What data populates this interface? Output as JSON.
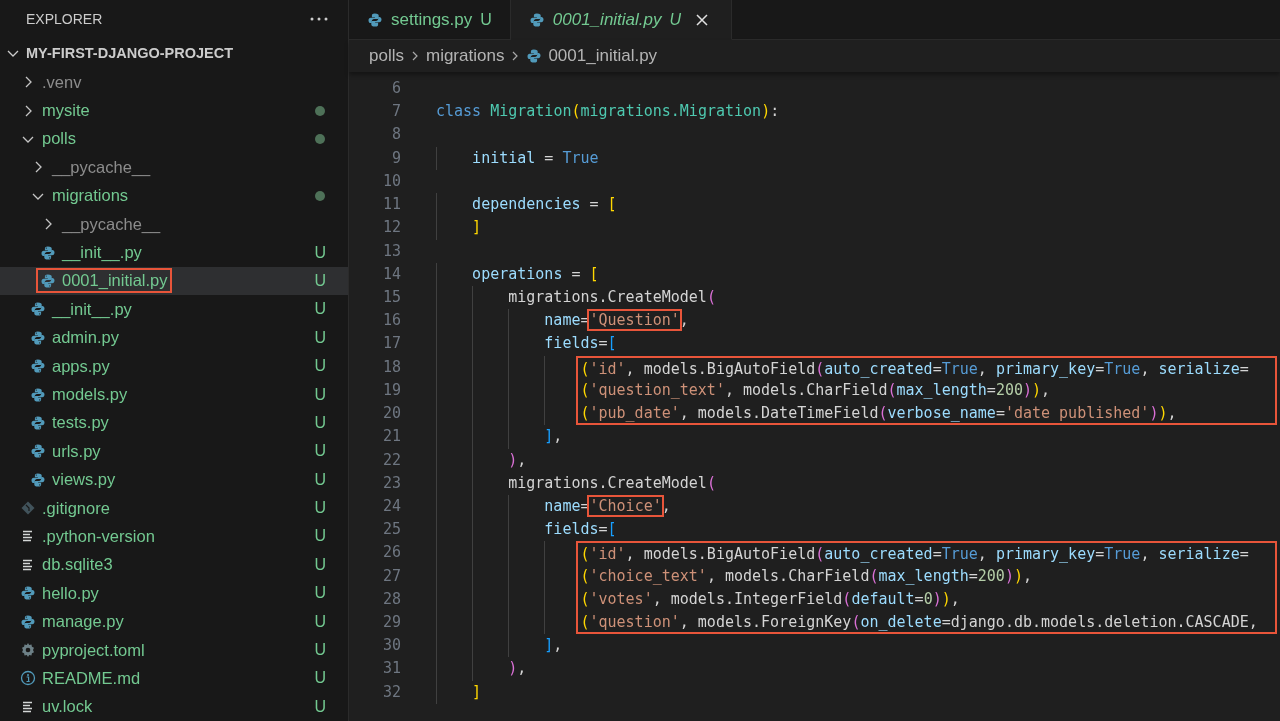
{
  "sidebar": {
    "title": "EXPLORER",
    "project": {
      "name": "MY-FIRST-DJANGO-PROJECT",
      "expanded": true
    },
    "tree": [
      {
        "name": ".venv",
        "kind": "folder",
        "expanded": false,
        "dimmed": true,
        "modified": false,
        "selected": false
      },
      {
        "name": "mysite",
        "kind": "folder",
        "expanded": false,
        "dimmed": false,
        "modified": true,
        "selected": false
      },
      {
        "name": "polls",
        "kind": "folder",
        "expanded": true,
        "dimmed": false,
        "modified": true,
        "selected": false,
        "children": [
          {
            "name": "__pycache__",
            "kind": "folder",
            "expanded": false,
            "dimmed": true,
            "modified": false,
            "selected": false
          },
          {
            "name": "migrations",
            "kind": "folder",
            "expanded": true,
            "dimmed": false,
            "modified": true,
            "selected": false,
            "children": [
              {
                "name": "__pycache__",
                "kind": "folder",
                "expanded": false,
                "dimmed": true,
                "modified": false,
                "selected": false
              },
              {
                "name": "__init__.py",
                "kind": "python",
                "status": "U",
                "selected": false
              },
              {
                "name": "0001_initial.py",
                "kind": "python",
                "status": "U",
                "selected": true,
                "marked": true
              }
            ]
          },
          {
            "name": "__init__.py",
            "kind": "python",
            "status": "U",
            "selected": false
          },
          {
            "name": "admin.py",
            "kind": "python",
            "status": "U",
            "selected": false
          },
          {
            "name": "apps.py",
            "kind": "python",
            "status": "U",
            "selected": false
          },
          {
            "name": "models.py",
            "kind": "python",
            "status": "U",
            "selected": false
          },
          {
            "name": "tests.py",
            "kind": "python",
            "status": "U",
            "selected": false
          },
          {
            "name": "urls.py",
            "kind": "python",
            "status": "U",
            "selected": false
          },
          {
            "name": "views.py",
            "kind": "python",
            "status": "U",
            "selected": false
          }
        ]
      },
      {
        "name": ".gitignore",
        "kind": "git",
        "status": "U",
        "selected": false
      },
      {
        "name": ".python-version",
        "kind": "text",
        "status": "U",
        "selected": false
      },
      {
        "name": "db.sqlite3",
        "kind": "text",
        "status": "U",
        "selected": false
      },
      {
        "name": "hello.py",
        "kind": "python",
        "status": "U",
        "selected": false
      },
      {
        "name": "manage.py",
        "kind": "python",
        "status": "U",
        "selected": false
      },
      {
        "name": "pyproject.toml",
        "kind": "gear",
        "status": "U",
        "selected": false
      },
      {
        "name": "README.md",
        "kind": "info",
        "status": "U",
        "selected": false
      },
      {
        "name": "uv.lock",
        "kind": "text",
        "status": "U",
        "selected": false
      }
    ]
  },
  "tabs": [
    {
      "label": "settings.py",
      "status": "U",
      "selected": false,
      "preview": false
    },
    {
      "label": "0001_initial.py",
      "status": "U",
      "selected": true,
      "preview": true
    }
  ],
  "breadcrumb": [
    "polls",
    "migrations",
    "0001_initial.py"
  ],
  "editor": {
    "lines": [
      {
        "number": "6"
      },
      {
        "number": "7",
        "tokens": [
          {
            "text": "class ",
            "kind": "kw"
          },
          {
            "text": "Migration",
            "kind": "cls"
          },
          {
            "text": "(",
            "kind": "b1"
          },
          {
            "text": "migrations.Migration",
            "kind": "cls"
          },
          {
            "text": ")",
            "kind": "b1"
          },
          {
            "text": ":",
            "kind": "plain"
          }
        ]
      },
      {
        "number": "8"
      },
      {
        "number": "9",
        "tokens": [
          {
            "text": "    initial",
            "kind": "var"
          },
          {
            "text": " = ",
            "kind": "plain"
          },
          {
            "text": "True",
            "kind": "const"
          }
        ]
      },
      {
        "number": "10"
      },
      {
        "number": "11",
        "tokens": [
          {
            "text": "    dependencies",
            "kind": "var"
          },
          {
            "text": " = ",
            "kind": "plain"
          },
          {
            "text": "[",
            "kind": "b1"
          }
        ]
      },
      {
        "number": "12",
        "tokens": [
          {
            "text": "    ]",
            "kind": "b1"
          }
        ]
      },
      {
        "number": "13"
      },
      {
        "number": "14",
        "tokens": [
          {
            "text": "    operations",
            "kind": "var"
          },
          {
            "text": " = ",
            "kind": "plain"
          },
          {
            "text": "[",
            "kind": "b1"
          }
        ]
      },
      {
        "number": "15",
        "tokens": [
          {
            "text": "        migrations.CreateModel",
            "kind": "plain"
          },
          {
            "text": "(",
            "kind": "b2"
          }
        ]
      },
      {
        "number": "16",
        "tokens": [
          {
            "text": "            name",
            "kind": "var"
          },
          {
            "text": "=",
            "kind": "plain"
          },
          {
            "text": "'Question'",
            "kind": "str",
            "boxed": true
          },
          {
            "text": ",",
            "kind": "plain"
          }
        ]
      },
      {
        "number": "17",
        "tokens": [
          {
            "text": "            fields",
            "kind": "var"
          },
          {
            "text": "=",
            "kind": "plain"
          },
          {
            "text": "[",
            "kind": "b3"
          }
        ]
      },
      {
        "number": "18",
        "boxed": true,
        "tokens": [
          {
            "text": "                (",
            "kind": "b1"
          },
          {
            "text": "'id'",
            "kind": "str"
          },
          {
            "text": ", models.BigAutoField",
            "kind": "plain"
          },
          {
            "text": "(",
            "kind": "b2"
          },
          {
            "text": "auto_created",
            "kind": "var"
          },
          {
            "text": "=",
            "kind": "plain"
          },
          {
            "text": "True",
            "kind": "const"
          },
          {
            "text": ", ",
            "kind": "plain"
          },
          {
            "text": "primary_key",
            "kind": "var"
          },
          {
            "text": "=",
            "kind": "plain"
          },
          {
            "text": "True",
            "kind": "const"
          },
          {
            "text": ", ",
            "kind": "plain"
          },
          {
            "text": "serialize",
            "kind": "var"
          },
          {
            "text": "=",
            "kind": "plain"
          }
        ]
      },
      {
        "number": "19",
        "boxed": true,
        "tokens": [
          {
            "text": "                (",
            "kind": "b1"
          },
          {
            "text": "'question_text'",
            "kind": "str"
          },
          {
            "text": ", models.CharField",
            "kind": "plain"
          },
          {
            "text": "(",
            "kind": "b2"
          },
          {
            "text": "max_length",
            "kind": "var"
          },
          {
            "text": "=",
            "kind": "plain"
          },
          {
            "text": "200",
            "kind": "num"
          },
          {
            "text": ")",
            "kind": "b2"
          },
          {
            "text": ")",
            "kind": "b1"
          },
          {
            "text": ",",
            "kind": "plain"
          }
        ]
      },
      {
        "number": "20",
        "boxed": true,
        "tokens": [
          {
            "text": "                (",
            "kind": "b1"
          },
          {
            "text": "'pub_date'",
            "kind": "str"
          },
          {
            "text": ", models.DateTimeField",
            "kind": "plain"
          },
          {
            "text": "(",
            "kind": "b2"
          },
          {
            "text": "verbose_name",
            "kind": "var"
          },
          {
            "text": "=",
            "kind": "plain"
          },
          {
            "text": "'date published'",
            "kind": "str"
          },
          {
            "text": ")",
            "kind": "b2"
          },
          {
            "text": ")",
            "kind": "b1"
          },
          {
            "text": ",",
            "kind": "plain"
          }
        ]
      },
      {
        "number": "21",
        "tokens": [
          {
            "text": "            ]",
            "kind": "b3"
          },
          {
            "text": ",",
            "kind": "plain"
          }
        ]
      },
      {
        "number": "22",
        "tokens": [
          {
            "text": "        )",
            "kind": "b2"
          },
          {
            "text": ",",
            "kind": "plain"
          }
        ]
      },
      {
        "number": "23",
        "tokens": [
          {
            "text": "        migrations.CreateModel",
            "kind": "plain"
          },
          {
            "text": "(",
            "kind": "b2"
          }
        ]
      },
      {
        "number": "24",
        "tokens": [
          {
            "text": "            name",
            "kind": "var"
          },
          {
            "text": "=",
            "kind": "plain"
          },
          {
            "text": "'Choice'",
            "kind": "str",
            "boxed": true
          },
          {
            "text": ",",
            "kind": "plain"
          }
        ]
      },
      {
        "number": "25",
        "tokens": [
          {
            "text": "            fields",
            "kind": "var"
          },
          {
            "text": "=",
            "kind": "plain"
          },
          {
            "text": "[",
            "kind": "b3"
          }
        ]
      },
      {
        "number": "26",
        "boxed": true,
        "tokens": [
          {
            "text": "                (",
            "kind": "b1"
          },
          {
            "text": "'id'",
            "kind": "str"
          },
          {
            "text": ", models.BigAutoField",
            "kind": "plain"
          },
          {
            "text": "(",
            "kind": "b2"
          },
          {
            "text": "auto_created",
            "kind": "var"
          },
          {
            "text": "=",
            "kind": "plain"
          },
          {
            "text": "True",
            "kind": "const"
          },
          {
            "text": ", ",
            "kind": "plain"
          },
          {
            "text": "primary_key",
            "kind": "var"
          },
          {
            "text": "=",
            "kind": "plain"
          },
          {
            "text": "True",
            "kind": "const"
          },
          {
            "text": ", ",
            "kind": "plain"
          },
          {
            "text": "serialize",
            "kind": "var"
          },
          {
            "text": "=",
            "kind": "plain"
          }
        ]
      },
      {
        "number": "27",
        "boxed": true,
        "tokens": [
          {
            "text": "                (",
            "kind": "b1"
          },
          {
            "text": "'choice_text'",
            "kind": "str"
          },
          {
            "text": ", models.CharField",
            "kind": "plain"
          },
          {
            "text": "(",
            "kind": "b2"
          },
          {
            "text": "max_length",
            "kind": "var"
          },
          {
            "text": "=",
            "kind": "plain"
          },
          {
            "text": "200",
            "kind": "num"
          },
          {
            "text": ")",
            "kind": "b2"
          },
          {
            "text": ")",
            "kind": "b1"
          },
          {
            "text": ",",
            "kind": "plain"
          }
        ]
      },
      {
        "number": "28",
        "boxed": true,
        "tokens": [
          {
            "text": "                (",
            "kind": "b1"
          },
          {
            "text": "'votes'",
            "kind": "str"
          },
          {
            "text": ", models.IntegerField",
            "kind": "plain"
          },
          {
            "text": "(",
            "kind": "b2"
          },
          {
            "text": "default",
            "kind": "var"
          },
          {
            "text": "=",
            "kind": "plain"
          },
          {
            "text": "0",
            "kind": "num"
          },
          {
            "text": ")",
            "kind": "b2"
          },
          {
            "text": ")",
            "kind": "b1"
          },
          {
            "text": ",",
            "kind": "plain"
          }
        ]
      },
      {
        "number": "29",
        "boxed": true,
        "tokens": [
          {
            "text": "                (",
            "kind": "b1"
          },
          {
            "text": "'question'",
            "kind": "str"
          },
          {
            "text": ", models.ForeignKey",
            "kind": "plain"
          },
          {
            "text": "(",
            "kind": "b2"
          },
          {
            "text": "on_delete",
            "kind": "var"
          },
          {
            "text": "=",
            "kind": "plain"
          },
          {
            "text": "django.db.models.deletion.CASCADE,",
            "kind": "plain"
          }
        ]
      },
      {
        "number": "30",
        "tokens": [
          {
            "text": "            ]",
            "kind": "b3"
          },
          {
            "text": ",",
            "kind": "plain"
          }
        ]
      },
      {
        "number": "31",
        "tokens": [
          {
            "text": "        )",
            "kind": "b2"
          },
          {
            "text": ",",
            "kind": "plain"
          }
        ]
      },
      {
        "number": "32",
        "tokens": [
          {
            "text": "    ]",
            "kind": "b1"
          }
        ]
      }
    ]
  }
}
